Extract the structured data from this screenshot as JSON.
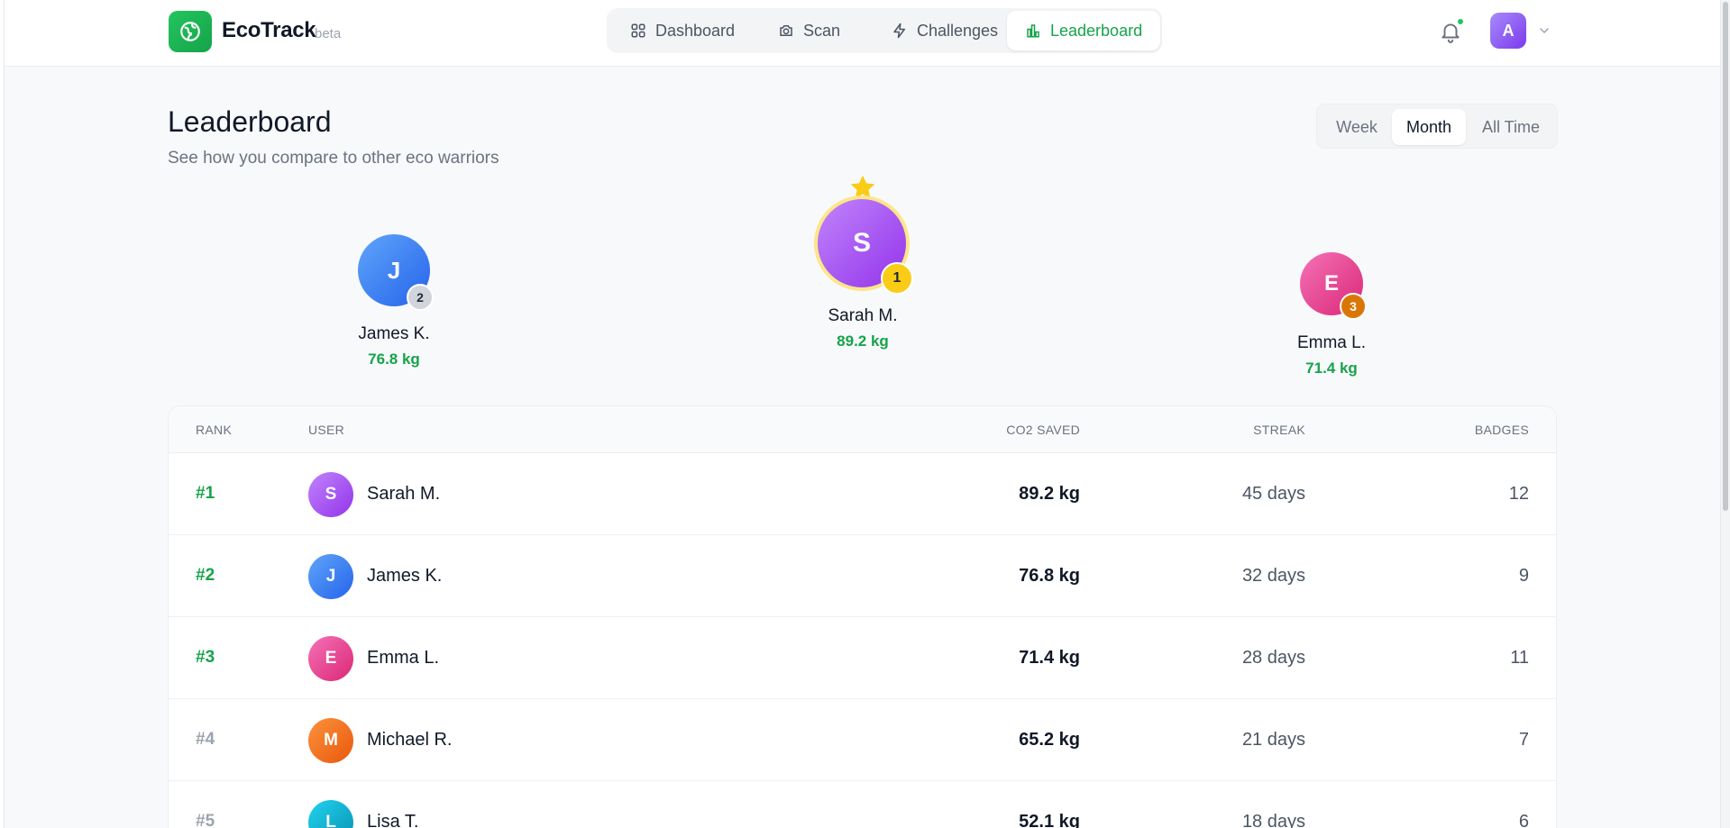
{
  "brand": {
    "name": "EcoTrack",
    "tag": "beta",
    "logo_icon": "leaf-globe-icon",
    "accent": "#16a34a"
  },
  "nav": [
    {
      "label": "Dashboard",
      "icon": "grid-icon",
      "active": false
    },
    {
      "label": "Scan",
      "icon": "camera-icon",
      "active": false
    },
    {
      "label": "Challenges",
      "icon": "lightning-icon",
      "active": false
    },
    {
      "label": "Leaderboard",
      "icon": "bar-chart-icon",
      "active": true
    }
  ],
  "user": {
    "initial": "A",
    "notification_icon": "bell-icon",
    "has_notification": true
  },
  "page": {
    "title": "Leaderboard",
    "subtitle": "See how you compare to other eco warriors"
  },
  "range": {
    "options": [
      "Week",
      "Month",
      "All Time"
    ],
    "selected": "Month"
  },
  "podium": {
    "first": {
      "initial": "S",
      "name": "Sarah M.",
      "value": "89.2 kg",
      "rank": "1"
    },
    "second": {
      "initial": "J",
      "name": "James K.",
      "value": "76.8 kg",
      "rank": "2"
    },
    "third": {
      "initial": "E",
      "name": "Emma L.",
      "value": "71.4 kg",
      "rank": "3"
    }
  },
  "table": {
    "headers": {
      "rank": "RANK",
      "user": "USER",
      "co2": "CO2 SAVED",
      "streak": "STREAK",
      "badges": "BADGES"
    },
    "rows": [
      {
        "rank": "#1",
        "initial": "S",
        "name": "Sarah M.",
        "co2": "89.2 kg",
        "streak": "45 days",
        "badges": "12"
      },
      {
        "rank": "#2",
        "initial": "J",
        "name": "James K.",
        "co2": "76.8 kg",
        "streak": "32 days",
        "badges": "9"
      },
      {
        "rank": "#3",
        "initial": "E",
        "name": "Emma L.",
        "co2": "71.4 kg",
        "streak": "28 days",
        "badges": "11"
      },
      {
        "rank": "#4",
        "initial": "M",
        "name": "Michael R.",
        "co2": "65.2 kg",
        "streak": "21 days",
        "badges": "7"
      },
      {
        "rank": "#5",
        "initial": "L",
        "name": "Lisa T.",
        "co2": "52.1 kg",
        "streak": "18 days",
        "badges": "6"
      }
    ]
  },
  "colors": {
    "purple": "#a855f7",
    "blue": "#3b82f6",
    "pink": "#ec4899",
    "orange": "#f97316",
    "cyan": "#06b6d4",
    "gold": "#facc15",
    "silver": "#d1d5db",
    "bronze": "#d97706"
  }
}
